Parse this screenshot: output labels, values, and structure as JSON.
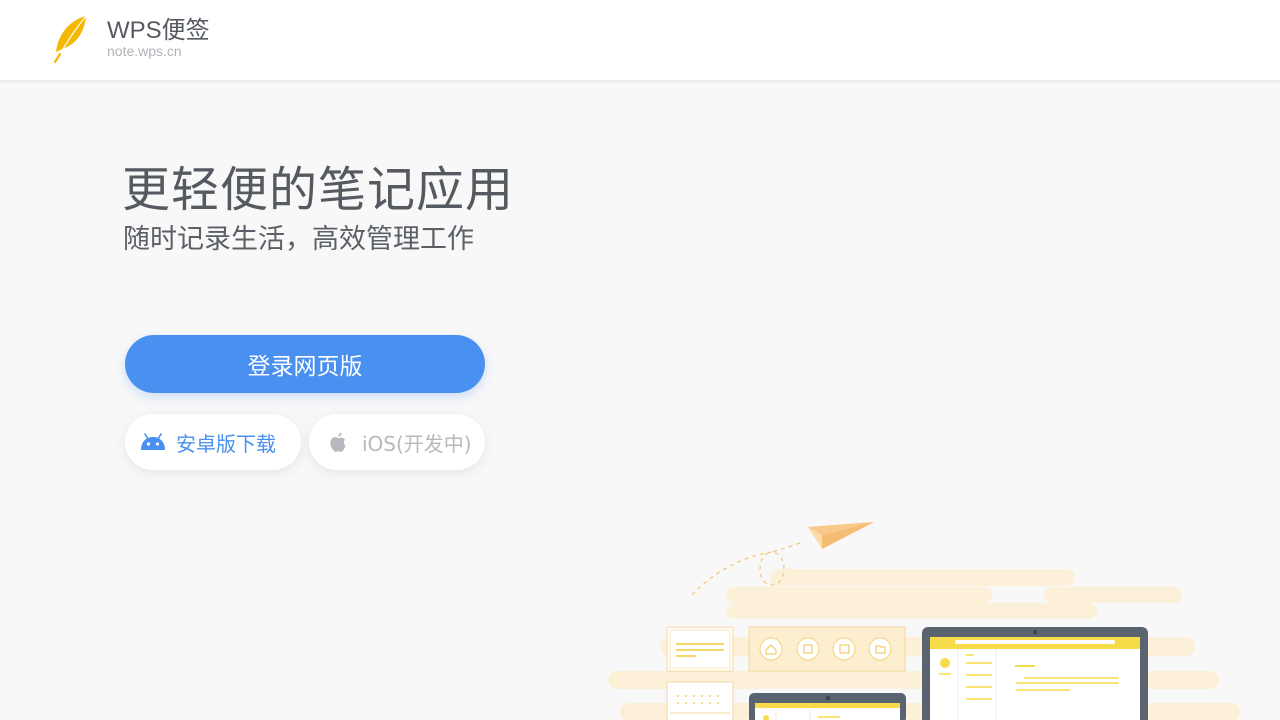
{
  "header": {
    "brand_title": "WPS便签",
    "brand_url": "note.wps.cn",
    "logo_icon": "feather-logo-icon"
  },
  "hero": {
    "title": "更轻便的笔记应用",
    "subtitle": "随时记录生活，高效管理工作"
  },
  "actions": {
    "login_web_label": "登录网页版",
    "android_label": "安卓版下载",
    "android_icon": "android-icon",
    "ios_label": "iOS(开发中)",
    "ios_icon": "apple-icon"
  },
  "colors": {
    "accent_blue": "#4a90f0",
    "logo_yellow": "#f5b800",
    "illustration_yellow": "#f7dc4a",
    "cloud_beige": "#fdf0d9",
    "device_gray": "#5a6470",
    "text_gray": "#555a60",
    "disabled_gray": "#b6b9be"
  }
}
